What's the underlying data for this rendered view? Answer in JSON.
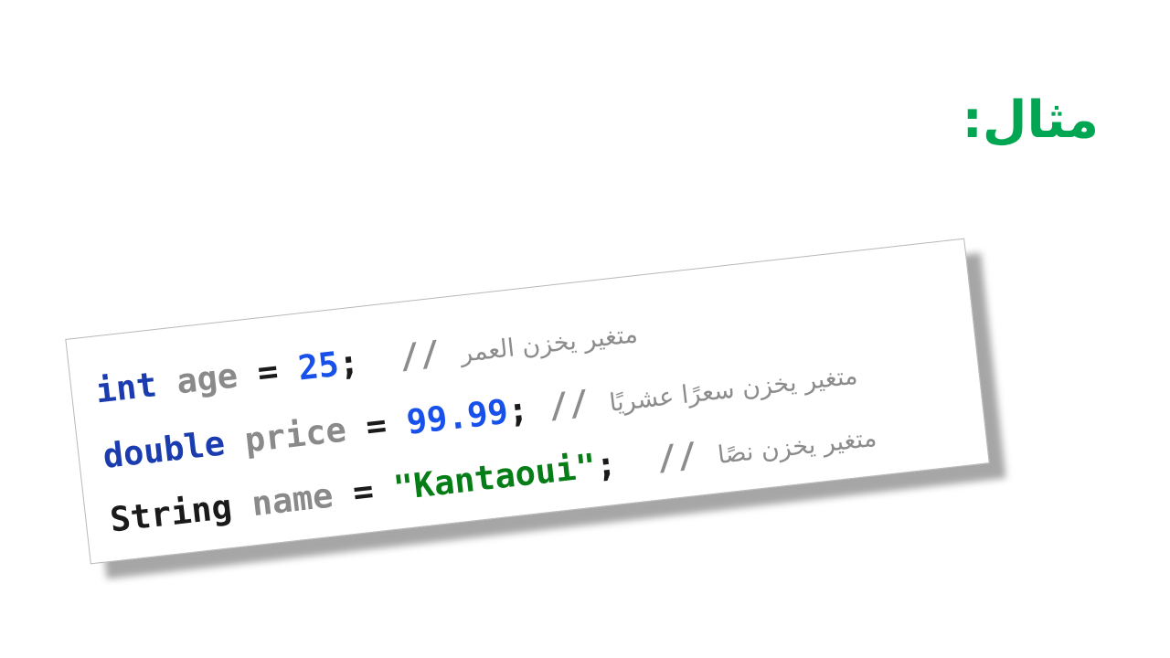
{
  "slide": {
    "title": "مثال:",
    "title_color": "#00a651"
  },
  "code": {
    "lines": [
      {
        "type": "int",
        "name": "age",
        "op": "=",
        "value": "25",
        "terminator": ";",
        "comment_marker": "//",
        "comment_text": "متغير يخزن العمر"
      },
      {
        "type": "double",
        "name": "price",
        "op": "=",
        "value": "99.99",
        "terminator": ";",
        "comment_marker": "//",
        "comment_text": "متغير يخزن سعرًا عشريًا"
      },
      {
        "type": "String",
        "name": "name",
        "op": "=",
        "value": "\"Kantaoui\"",
        "terminator": ";",
        "comment_marker": "//",
        "comment_text": "متغير يخزن نصًا"
      }
    ],
    "colors": {
      "keyword": "#1a3cae",
      "number": "#1750eb",
      "string": "#067d17",
      "identifier": "#8a8a8a",
      "comment": "#8c8c8c"
    }
  }
}
